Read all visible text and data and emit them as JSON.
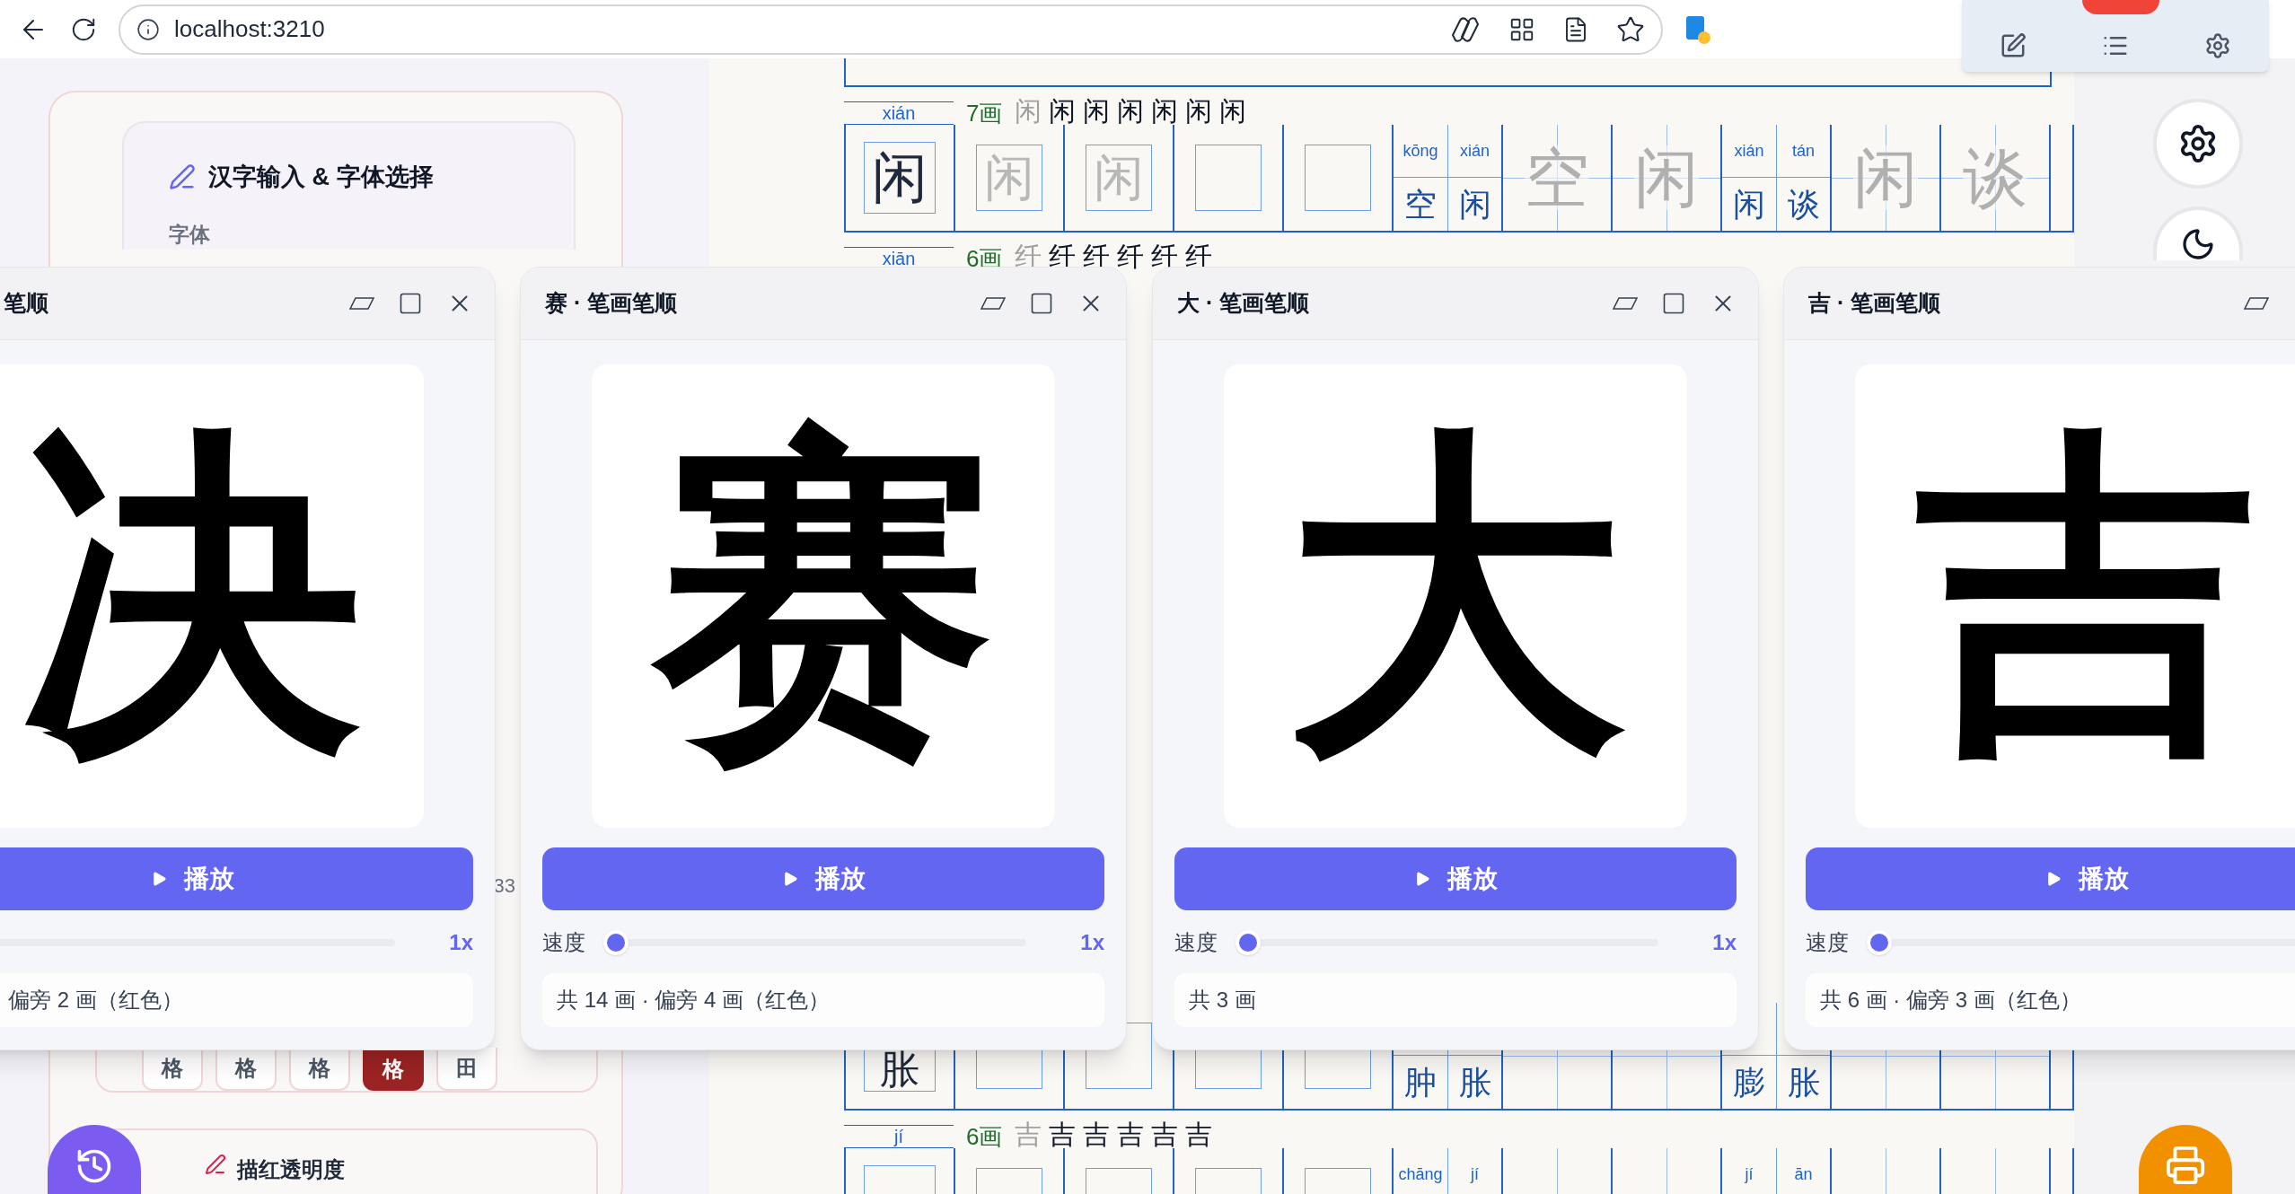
{
  "browser": {
    "url": "localhost:3210"
  },
  "sidebar": {
    "title": "汉字输入 & 字体选择",
    "font_label": "字体",
    "count": "33",
    "grid_buttons": [
      {
        "label": "格",
        "selected": false
      },
      {
        "label": "格",
        "selected": false
      },
      {
        "label": "格",
        "selected": false
      },
      {
        "label": "格",
        "selected": true
      },
      {
        "label": "田",
        "selected": false
      }
    ],
    "opacity_label": "描红透明度"
  },
  "worksheet": [
    {
      "kind": "partial"
    },
    {
      "kind": "header",
      "pinyin": "xián",
      "strokes": "7画",
      "sequence": [
        "闲",
        "闲",
        "闲",
        "闲",
        "闲",
        "闲",
        "闲"
      ]
    },
    {
      "kind": "row",
      "char": "闲",
      "practice": [
        "闲",
        "闲"
      ],
      "words": [
        {
          "pinyin": [
            "kōng",
            "xián"
          ],
          "chars": [
            "空",
            "闲"
          ],
          "trace": [
            "空",
            "闲"
          ]
        },
        {
          "pinyin": [
            "xián",
            "tán"
          ],
          "chars": [
            "闲",
            "谈"
          ],
          "trace": [
            "闲",
            "谈"
          ]
        }
      ]
    },
    {
      "kind": "header",
      "pinyin": "xiān",
      "strokes": "6画",
      "sequence": [
        "纤",
        "纤",
        "纤",
        "纤",
        "纤",
        "纤"
      ]
    },
    {
      "kind": "hidden"
    },
    {
      "kind": "row",
      "char": "胀",
      "words": [
        {
          "chars": [
            "肿",
            "胀"
          ]
        },
        {
          "chars": [
            "膨",
            "胀"
          ]
        }
      ]
    },
    {
      "kind": "header",
      "pinyin": "jí",
      "strokes": "6画",
      "sequence": [
        "吉",
        "吉",
        "吉",
        "吉",
        "吉",
        "吉"
      ]
    },
    {
      "kind": "row",
      "words": [
        {
          "pinyin": [
            "chāng",
            "jí"
          ]
        },
        {
          "pinyin": [
            "jí",
            "ān"
          ]
        }
      ]
    }
  ],
  "windows": [
    {
      "title": "笔顺",
      "char": "决",
      "play": "播放",
      "speed_value": "1x",
      "info": "偏旁 2 画（红色）"
    },
    {
      "title": "赛 · 笔画笔顺",
      "char": "赛",
      "play": "播放",
      "speed_label": "速度",
      "level": 0,
      "speed_value": "1x",
      "info": "共 14 画 · 偏旁 4 画（红色）"
    },
    {
      "title": "大 · 笔画笔顺",
      "char": "大",
      "play": "播放",
      "speed_label": "速度",
      "level": 0,
      "speed_value": "1x",
      "info": "共 3 画"
    },
    {
      "title": "吉 · 笔画笔顺",
      "char": "吉",
      "play": "播放",
      "speed_label": "速度",
      "level": 0,
      "info": "共 6 画 · 偏旁 3 画（红色）"
    }
  ]
}
